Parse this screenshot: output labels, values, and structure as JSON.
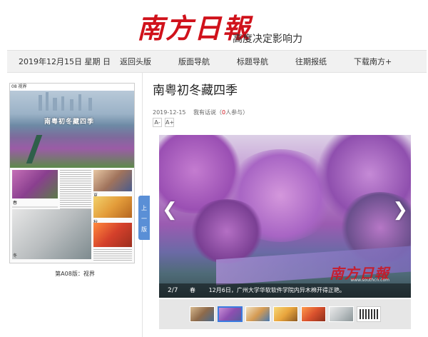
{
  "header": {
    "logo_text": "南方日報",
    "slogan": "高度决定影响力"
  },
  "nav": {
    "date": "2019年12月15日 星期 日",
    "items": [
      "返回头版",
      "版面导航",
      "标题导航",
      "往期报纸",
      "下载南方+"
    ]
  },
  "left_panel": {
    "page_label": "08 视界",
    "hero_title": "南粤初冬藏四季",
    "season_labels": [
      "春",
      "夏",
      "秋",
      "冬"
    ],
    "caption": "第A08版：视界",
    "prev_tab": [
      "上",
      "一",
      "版"
    ]
  },
  "article": {
    "title": "南粤初冬藏四季",
    "date": "2019-12-15",
    "comment_label": "我有话说（",
    "comment_count": "0",
    "comment_suffix": "人参与）",
    "font_smaller": "A-",
    "font_larger": "A+"
  },
  "gallery": {
    "index": "2/7",
    "season": "春",
    "caption": "12月6日，广州大学华软软件学院内异木棉开得正艳。",
    "watermark": "南方日報",
    "watermark_url": "www.southcn.com",
    "prev_icon": "chevron-left-icon",
    "next_icon": "chevron-right-icon",
    "active_thumb": 1,
    "thumb_count": 7
  },
  "colors": {
    "brand_red": "#d0121b",
    "nav_bg": "#f1f1f1",
    "prev_tab": "#5a8fd6",
    "active_thumb_border": "#3a7be0"
  }
}
